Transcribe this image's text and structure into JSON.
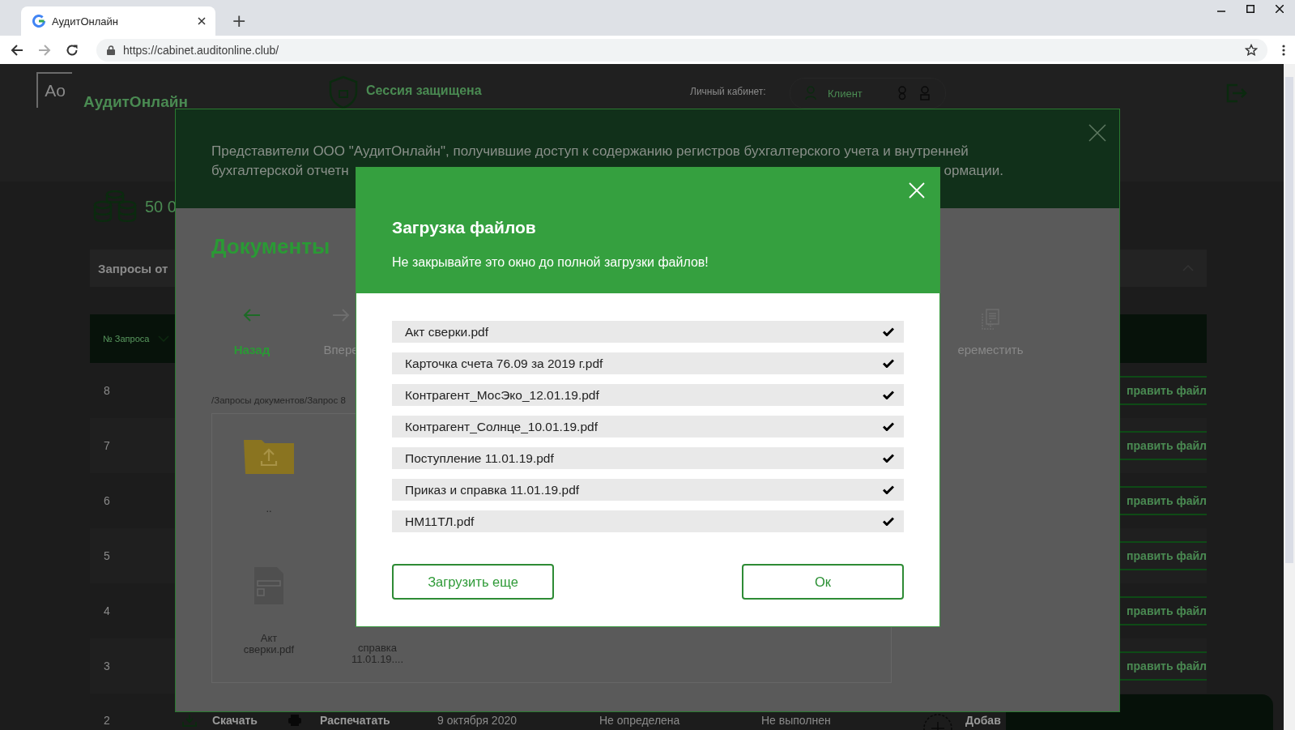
{
  "browser": {
    "tab": {
      "title": "АудитОнлайн",
      "selected": true
    },
    "new_tab": "+",
    "url": "https://cabinet.auditonline.club/"
  },
  "page": {
    "logo_mark": "Ao",
    "logo_text": "АудитОнлайн",
    "session": "Сессия защищена",
    "cabinet_label": "Личный кабинет:",
    "role": "Клиент",
    "balance": "50 0",
    "requests_title": "Запросы от",
    "table": {
      "column_1": "№ Запроса",
      "rows": [
        {
          "number": "8",
          "action": "править файл"
        },
        {
          "number": "7",
          "action": "править файл"
        },
        {
          "number": "6",
          "action": "править файл"
        },
        {
          "number": "5",
          "action": "править файл"
        },
        {
          "number": "4",
          "action": "править файл"
        },
        {
          "number": "3",
          "action": "править файл"
        }
      ],
      "last_row": {
        "number": "2",
        "download": "Скачать",
        "print": "Распечатать",
        "date": "9 октября 2020",
        "column_4": "Не определена",
        "status": "Не выполнен"
      }
    },
    "add_button": "Добав"
  },
  "notice": {
    "line_1": "Представители ООО \"АудитОнлайн\", получившие доступ к содержанию регистров бухгалтерского учета и внутренней",
    "line_2_start": "бухгалтерской отчетн",
    "line_2_end": "ормации."
  },
  "documents": {
    "title": "Документы",
    "nav": [
      {
        "kind": "back",
        "label": "Назад",
        "disabled": false
      },
      {
        "kind": "forward",
        "label": "Впере",
        "disabled": true
      }
    ],
    "move": {
      "label": "еремеcтить",
      "disabled": true
    },
    "path": "/Запросы документов/Запрос 8",
    "file_rows": [
      [
        {
          "kind": "folder",
          "name": ".."
        }
      ],
      [
        {
          "kind": "document",
          "name": "Акт сверки.pdf"
        },
        {
          "kind": "caption",
          "name": "справка 11.01.19...."
        }
      ]
    ]
  },
  "upload": {
    "title": "Загрузка файлов",
    "subtitle": "Не закрывайте это окно до полной загрузки файлов!",
    "files": [
      {
        "name": "Акт сверки.pdf",
        "done": true
      },
      {
        "name": "Карточка счета 76.09 за 2019 г.pdf",
        "done": true
      },
      {
        "name": "Контрагент_МосЭко_12.01.19.pdf",
        "done": true
      },
      {
        "name": "Контрагент_Солнце_10.01.19.pdf",
        "done": true
      },
      {
        "name": "Поступление 11.01.19.pdf",
        "done": true
      },
      {
        "name": "Приказ и справка 11.01.19.pdf",
        "done": true
      },
      {
        "name": "НМ11ТЛ.pdf",
        "done": true
      }
    ],
    "buttons": [
      {
        "kind": "secondary",
        "label": "Загрузить еще"
      },
      {
        "kind": "primary",
        "label": "Ок"
      }
    ]
  }
}
